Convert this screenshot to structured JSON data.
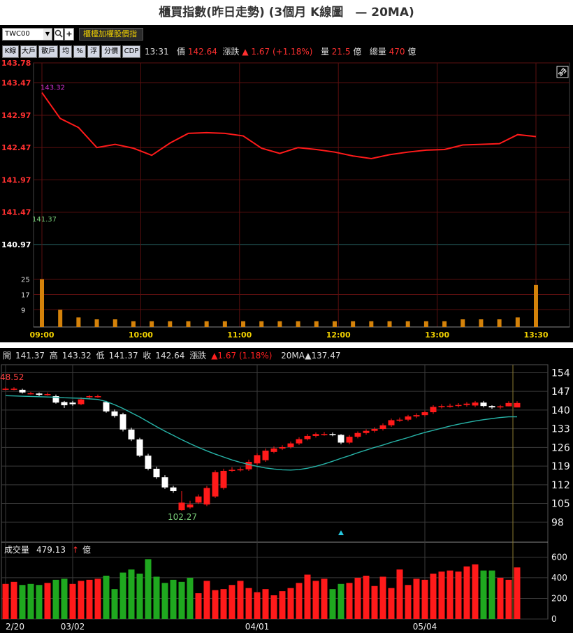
{
  "title": "櫃買指數(昨日走勢) (3個月 K線圖　— 20MA)",
  "toolbar": {
    "symbol": "TWC00",
    "dropdown_icon": "▼",
    "search_icon": "🔍",
    "plus_icon": "+",
    "index_button": "櫃檯加權股價指"
  },
  "mode_buttons": [
    "K線",
    "大戶",
    "散戶",
    "均",
    "%",
    "浮",
    "分價",
    "CDP"
  ],
  "quote": {
    "time": "13:31",
    "price_label": "價",
    "price": "142.64",
    "change_label": "漲跌",
    "change": "▲ 1.67 (+1.18%)",
    "volume_label": "量",
    "volume": "21.5",
    "volume_unit": "億",
    "total_volume_label": "總量",
    "total_volume": "470",
    "total_volume_unit": "億"
  },
  "intraday_chart": {
    "price_ticks": [
      "143.78",
      "143.47",
      "142.97",
      "142.47",
      "141.97",
      "141.47",
      "140.97"
    ],
    "high_label": "143.32",
    "low_label": "141.37",
    "reference_price": 140.97,
    "volume_ticks": [
      "25",
      "17",
      "9"
    ],
    "time_ticks": [
      "09:00",
      "10:00",
      "11:00",
      "12:00",
      "13:00",
      "13:30"
    ],
    "link_icon": "link-icon"
  },
  "daily_chart": {
    "info": {
      "open_label": "開",
      "open": "141.37",
      "high_label": "高",
      "high": "143.32",
      "low_label": "低",
      "low": "141.37",
      "close_label": "收",
      "close": "142.64",
      "change_label": "漲跌",
      "change": "▲1.67 (1.18%)",
      "ma_label": "20MA",
      "ma_value": "▲137.47"
    },
    "price_ticks": [
      "154",
      "147",
      "140",
      "133",
      "126",
      "119",
      "112",
      "105",
      "98"
    ],
    "max_label": "48.52",
    "min_label": "102.27",
    "volume_title": "成交量",
    "volume_value": "479.13",
    "volume_arrow": "↑",
    "volume_unit": "億",
    "volume_ticks": [
      "600",
      "400",
      "200",
      "0"
    ],
    "date_ticks": [
      "2/20",
      "03/02",
      "04/01",
      "05/04"
    ]
  },
  "chart_data": [
    {
      "type": "line",
      "title": "櫃買指數(昨日走勢)",
      "x": [
        "09:00",
        "09:10",
        "09:20",
        "09:30",
        "09:40",
        "09:50",
        "10:00",
        "10:10",
        "10:20",
        "10:30",
        "10:40",
        "10:50",
        "11:00",
        "11:10",
        "11:20",
        "11:30",
        "11:40",
        "11:50",
        "12:00",
        "12:10",
        "12:20",
        "12:30",
        "12:40",
        "12:50",
        "13:00",
        "13:10",
        "13:20",
        "13:30"
      ],
      "series": [
        {
          "values": [
            143.32,
            142.92,
            142.78,
            142.47,
            142.52,
            142.46,
            142.35,
            142.54,
            142.69,
            142.7,
            142.69,
            142.65,
            142.46,
            142.38,
            142.47,
            142.44,
            142.4,
            142.34,
            142.3,
            142.36,
            142.4,
            142.43,
            142.44,
            142.51,
            142.52,
            142.53,
            142.67,
            142.64
          ]
        }
      ],
      "ylim": [
        140.97,
        143.78
      ],
      "volume": [
        25,
        9,
        5,
        4,
        4,
        3,
        3,
        3,
        3,
        3,
        3,
        3,
        3,
        3,
        3,
        3,
        3,
        3,
        3,
        3,
        3,
        3,
        3,
        4,
        4,
        4,
        5,
        22
      ],
      "volume_ylim": [
        0,
        30
      ]
    },
    {
      "type": "candlestick",
      "title": "3個月 K線圖",
      "categories": [
        "2/20",
        "2/21",
        "2/22",
        "2/23",
        "2/24",
        "2/27",
        "3/01",
        "3/02",
        "3/03",
        "3/06",
        "3/07",
        "3/08",
        "3/09",
        "3/10",
        "3/13",
        "3/14",
        "3/15",
        "3/16",
        "3/17",
        "3/20",
        "3/21",
        "3/22",
        "3/23",
        "3/24",
        "3/27",
        "3/28",
        "3/29",
        "3/30",
        "3/31",
        "4/01",
        "4/06",
        "4/07",
        "4/10",
        "4/11",
        "4/12",
        "4/13",
        "4/14",
        "4/17",
        "4/18",
        "4/19",
        "4/20",
        "4/21",
        "4/24",
        "4/25",
        "4/26",
        "4/27",
        "4/28",
        "5/02",
        "5/03",
        "5/04",
        "5/05",
        "5/06",
        "5/09",
        "5/10",
        "5/11",
        "5/12",
        "5/13",
        "5/16",
        "5/17",
        "5/18",
        "5/19",
        "5/20"
      ],
      "series": [
        {
          "name": "K",
          "open": [
            148.0,
            148.0,
            147.6,
            146.3,
            146.2,
            146.0,
            145.2,
            143.0,
            142.8,
            142.2,
            144.8,
            145.2,
            143.0,
            139.5,
            138.4,
            132.7,
            129.0,
            122.9,
            118.0,
            114.8,
            111.0,
            102.5,
            103.5,
            105.3,
            104.6,
            107.6,
            110.8,
            117.2,
            117.6,
            117.8,
            120.0,
            121.2,
            124.3,
            125.6,
            126.1,
            127.5,
            129.1,
            130.3,
            131.0,
            131.0,
            130.7,
            127.8,
            130.0,
            131.4,
            132.2,
            132.9,
            134.3,
            136.2,
            136.4,
            137.6,
            138.1,
            139.2,
            141.2,
            141.5,
            141.6,
            141.9,
            141.7,
            142.8,
            141.5,
            141.0,
            141.4,
            140.97
          ],
          "close": [
            148.0,
            148.0,
            146.6,
            146.3,
            145.7,
            146.0,
            142.8,
            141.8,
            142.2,
            144.0,
            145.2,
            145.2,
            139.5,
            137.8,
            132.7,
            129.0,
            122.9,
            118.0,
            114.8,
            111.0,
            109.6,
            105.3,
            104.6,
            107.6,
            110.8,
            116.7,
            117.2,
            117.6,
            117.8,
            120.6,
            123.1,
            124.8,
            125.6,
            126.1,
            127.5,
            129.1,
            130.3,
            131.0,
            131.0,
            130.7,
            127.8,
            130.0,
            131.4,
            132.2,
            132.9,
            134.3,
            136.2,
            136.4,
            137.6,
            138.1,
            139.2,
            141.2,
            141.5,
            141.6,
            141.9,
            142.4,
            142.8,
            141.5,
            141.0,
            141.4,
            142.64,
            142.64
          ],
          "high": [
            148.6,
            148.6,
            148.0,
            146.8,
            146.6,
            146.6,
            145.8,
            143.4,
            143.4,
            144.8,
            145.6,
            145.8,
            143.4,
            140.2,
            139.0,
            133.4,
            129.6,
            123.6,
            118.8,
            115.6,
            111.6,
            109.6,
            106.0,
            108.4,
            111.6,
            117.4,
            118.0,
            118.6,
            118.6,
            121.4,
            123.8,
            125.6,
            126.4,
            126.8,
            128.2,
            129.8,
            131.0,
            131.6,
            131.8,
            131.6,
            131.0,
            130.6,
            132.0,
            132.8,
            133.6,
            135.0,
            136.8,
            137.2,
            138.2,
            138.8,
            139.8,
            141.8,
            142.2,
            142.4,
            142.6,
            143.0,
            143.4,
            143.4,
            141.8,
            141.9,
            143.32,
            143.32
          ],
          "low": [
            147.4,
            147.4,
            146.2,
            145.8,
            145.2,
            145.4,
            142.4,
            140.8,
            141.6,
            141.8,
            144.2,
            144.6,
            139.0,
            137.2,
            132.0,
            128.4,
            122.4,
            117.4,
            114.2,
            110.4,
            109.0,
            102.27,
            103.0,
            104.8,
            104.0,
            107.0,
            110.2,
            116.8,
            117.0,
            117.2,
            119.4,
            120.6,
            123.8,
            125.0,
            125.6,
            126.9,
            128.6,
            129.7,
            130.4,
            130.2,
            127.2,
            127.2,
            129.4,
            130.8,
            131.6,
            132.3,
            133.7,
            135.6,
            135.8,
            137.0,
            137.5,
            138.6,
            140.6,
            140.9,
            141.0,
            141.3,
            141.1,
            141.0,
            140.5,
            140.4,
            141.37,
            141.37
          ]
        },
        {
          "name": "20MA",
          "values": [
            145.4,
            145.3,
            145.2,
            145.1,
            145.0,
            144.9,
            144.8,
            144.6,
            144.5,
            144.4,
            144.2,
            144.0,
            143.2,
            142.0,
            140.6,
            139.0,
            137.4,
            135.6,
            133.8,
            132.1,
            130.5,
            128.9,
            127.4,
            126.0,
            124.7,
            123.5,
            122.4,
            121.3,
            120.4,
            119.6,
            118.9,
            118.3,
            117.9,
            117.6,
            117.5,
            117.7,
            118.2,
            118.9,
            119.8,
            120.8,
            121.9,
            122.9,
            124.0,
            125.0,
            126.0,
            126.9,
            127.9,
            128.8,
            129.7,
            130.7,
            131.6,
            132.4,
            133.2,
            134.0,
            134.7,
            135.3,
            135.9,
            136.4,
            136.8,
            137.2,
            137.47,
            137.47
          ]
        },
        {
          "name": "成交量",
          "values": [
            340,
            360,
            330,
            340,
            330,
            350,
            380,
            390,
            340,
            370,
            380,
            390,
            420,
            290,
            450,
            480,
            440,
            580,
            410,
            350,
            380,
            360,
            400,
            250,
            370,
            280,
            290,
            330,
            370,
            300,
            260,
            290,
            230,
            270,
            300,
            350,
            430,
            370,
            390,
            290,
            340,
            350,
            400,
            420,
            320,
            410,
            300,
            480,
            330,
            390,
            380,
            440,
            460,
            470,
            460,
            510,
            530,
            470,
            470,
            400,
            380,
            500
          ]
        }
      ],
      "ylim": [
        91,
        157
      ],
      "volume_ylim": [
        0,
        650
      ]
    }
  ]
}
